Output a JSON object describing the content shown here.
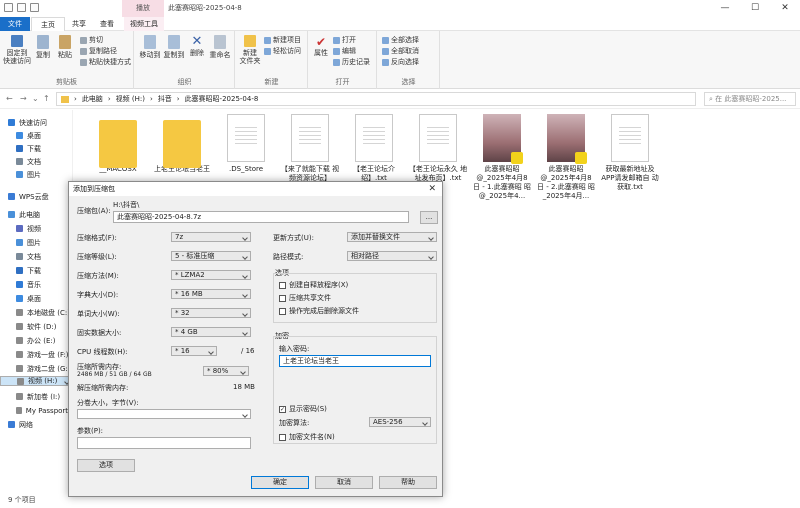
{
  "window": {
    "title": "此塞赛昭昭-2025-04-8",
    "context_tab": "播放",
    "controls": [
      "—",
      "☐",
      "✕"
    ]
  },
  "ribbon_tabs": [
    "文件",
    "主页",
    "共享",
    "查看",
    "视频工具"
  ],
  "ribbon": {
    "clipboard": {
      "label": "剪贴板",
      "pin": "固定到\n快速访问",
      "copy": "复制",
      "paste": "粘贴",
      "cut": "剪切",
      "copy_path": "复制路径",
      "paste_shortcut": "粘贴快捷方式"
    },
    "organize": {
      "label": "组织",
      "move_to": "移动到",
      "copy_to": "复制到",
      "delete": "删除",
      "rename": "重命名"
    },
    "new": {
      "label": "新建",
      "new_folder": "新建\n文件夹",
      "new_item": "新建项目",
      "easy_access": "轻松访问"
    },
    "open": {
      "label": "打开",
      "properties": "属性",
      "open": "打开",
      "edit": "编辑",
      "history": "历史记录"
    },
    "select": {
      "label": "选择",
      "select_all": "全部选择",
      "select_none": "全部取消",
      "invert": "反向选择"
    }
  },
  "address": {
    "crumbs": [
      "此电脑",
      "视频 (H:)",
      "抖音",
      "此塞赛昭昭-2025-04-8"
    ],
    "search_placeholder": "在 此塞赛昭昭-2025..."
  },
  "nav": [
    {
      "label": "快速访问",
      "color": "#2f7bd6"
    },
    {
      "label": "桌面",
      "color": "#3d8be0"
    },
    {
      "label": "下载",
      "color": "#2f6fc2"
    },
    {
      "label": "文档",
      "color": "#7a8a99"
    },
    {
      "label": "图片",
      "color": "#4a90d9"
    },
    {
      "label": "WPS云盘",
      "color": "#3a7bd5"
    },
    {
      "label": "此电脑",
      "color": "#4a90d9"
    },
    {
      "label": "视频",
      "color": "#5c6bc0"
    },
    {
      "label": "图片",
      "color": "#4a90d9"
    },
    {
      "label": "文档",
      "color": "#7a8a99"
    },
    {
      "label": "下载",
      "color": "#2f6fc2"
    },
    {
      "label": "音乐",
      "color": "#2f7bd6"
    },
    {
      "label": "桌面",
      "color": "#3d8be0"
    },
    {
      "label": "本地磁盘 (C:)",
      "color": "#8a8a8a"
    },
    {
      "label": "软件 (D:)",
      "color": "#8a8a8a"
    },
    {
      "label": "办公 (E:)",
      "color": "#8a8a8a"
    },
    {
      "label": "游戏一盘 (F:)",
      "color": "#8a8a8a"
    },
    {
      "label": "游戏二盘 (G:)",
      "color": "#8a8a8a"
    },
    {
      "label": "视频 (H:)",
      "color": "#8a8a8a"
    },
    {
      "label": "新加卷 (I:)",
      "color": "#8a8a8a"
    },
    {
      "label": "My Passport (",
      "color": "#8a8a8a"
    },
    {
      "label": "网络",
      "color": "#3a7bd5"
    }
  ],
  "files": [
    {
      "name": "__MACOSX",
      "kind": "folder"
    },
    {
      "name": "上老王论坛当老王",
      "kind": "folder"
    },
    {
      "name": ".DS_Store",
      "kind": "doc"
    },
    {
      "name": "【来了就能下载 视频资源论坛】",
      "kind": "doc"
    },
    {
      "name": "【老王论坛介 绍】.txt",
      "kind": "doc"
    },
    {
      "name": "【老王论坛永久 地址发布页】.txt",
      "kind": "doc"
    },
    {
      "name": "此塞赛昭昭 @_2025年4月8 日 - 1.此塞赛昭 昭@_2025年4...",
      "kind": "photo"
    },
    {
      "name": "此塞赛昭昭 @_2025年4月8 日 - 2.此塞赛昭 昭_2025年4月...",
      "kind": "photo"
    },
    {
      "name": "获取最新地址及 APP请发邮箱自 动获取.txt",
      "kind": "doc"
    }
  ],
  "status": "9 个项目",
  "dialog": {
    "title": "添加到压缩包",
    "archive_label": "压缩包(A):",
    "archive_dir": "H:\\抖音\\",
    "archive_name": "此塞赛昭昭-2025-04-8.7z",
    "browse": "...",
    "format_label": "压缩格式(F):",
    "format": "7z",
    "level_label": "压缩等级(L):",
    "level": "5 - 标准压缩",
    "method_label": "压缩方法(M):",
    "method": "* LZMA2",
    "dict_label": "字典大小(D):",
    "dict": "* 16 MB",
    "word_label": "单词大小(W):",
    "word": "* 32",
    "solid_label": "固实数据大小:",
    "solid": "* 4 GB",
    "threads_label": "CPU 线程数(H):",
    "threads": "* 16",
    "threads_total": "/ 16",
    "mem_label": "压缩所需内存:",
    "mem_detail": "2486 MB / 51 GB / 64 GB",
    "mem_percent": "* 80%",
    "decomp_label": "解压缩所需内存:",
    "decomp_value": "18 MB",
    "split_label": "分卷大小，字节(V):",
    "split_value": "",
    "params_label": "参数(P):",
    "params_value": "",
    "options_btn": "选项",
    "update_label": "更新方式(U):",
    "update": "添加并替换文件",
    "path_label": "路径模式:",
    "path": "相对路径",
    "opt_group": "选项",
    "opt_sfx": "创建自释放程序(X)",
    "opt_shared": "压缩共享文件",
    "opt_delete": "操作完成后删除源文件",
    "enc_group": "加密",
    "pwd_label": "输入密码:",
    "pwd_value": "上老王论坛当老王",
    "show_pwd": "显示密码(S)",
    "enc_method_label": "加密算法:",
    "enc_method": "AES-256",
    "enc_names": "加密文件名(N)",
    "ok": "确定",
    "cancel": "取消",
    "help": "帮助"
  }
}
